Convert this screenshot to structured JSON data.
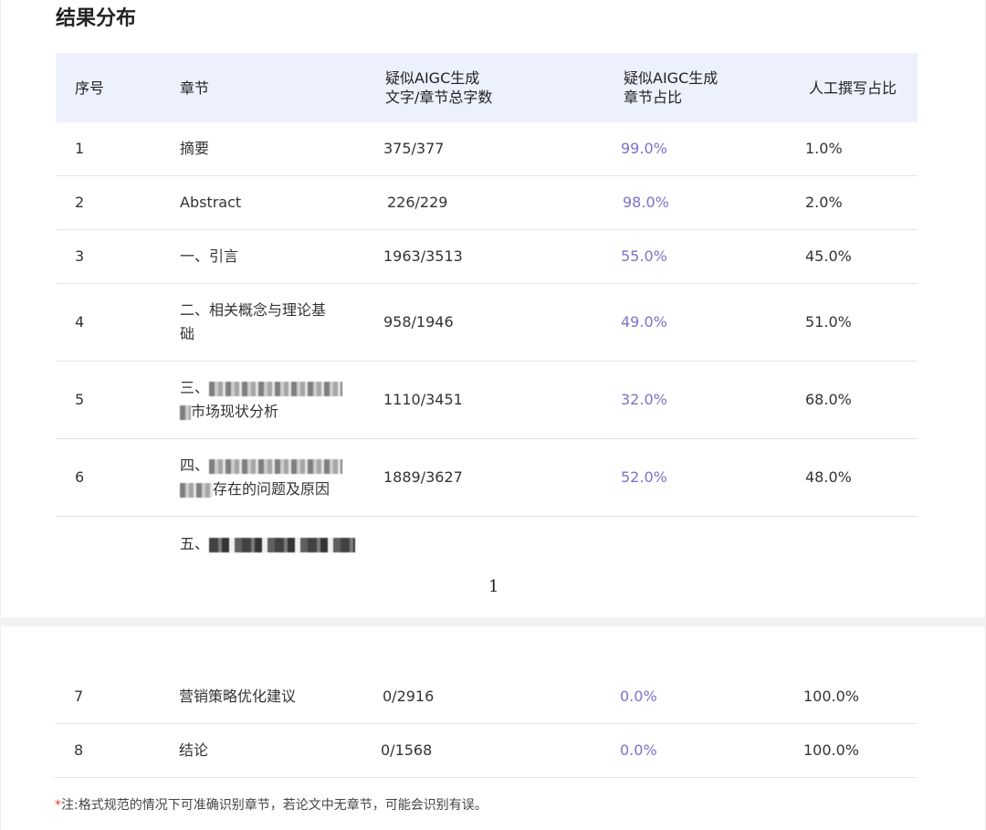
{
  "title": "结果分布",
  "table": {
    "headers": {
      "no": "序号",
      "chapter": "章节",
      "ai_chars_line1": "疑似AIGC生成",
      "ai_chars_line2": "文字/章节总字数",
      "ai_ratio_line1": "疑似AIGC生成",
      "ai_ratio_line2": "章节占比",
      "human_ratio": "人工撰写占比"
    },
    "rows": [
      {
        "no": "1",
        "chapter": "摘要",
        "ai_chars": "375/377",
        "ai_ratio": "99.0%",
        "human_ratio": "1.0%"
      },
      {
        "no": "2",
        "chapter": "Abstract",
        "ai_chars": "226/229",
        "ai_ratio": "98.0%",
        "human_ratio": "2.0%"
      },
      {
        "no": "3",
        "chapter": "一、引言",
        "ai_chars": "1963/3513",
        "ai_ratio": "55.0%",
        "human_ratio": "45.0%"
      },
      {
        "no": "4",
        "chapter_line1": "二、相关概念与理论基",
        "chapter_line2": "础",
        "ai_chars": "958/1946",
        "ai_ratio": "49.0%",
        "human_ratio": "51.0%"
      },
      {
        "no": "5",
        "chapter_prefix": "三、",
        "chapter_line2_suffix": "市场现状分析",
        "ai_chars": "1110/3451",
        "ai_ratio": "32.0%",
        "human_ratio": "68.0%"
      },
      {
        "no": "6",
        "chapter_prefix": "四、",
        "chapter_line2_suffix": "存在的问题及原因",
        "ai_chars": "1889/3627",
        "ai_ratio": "52.0%",
        "human_ratio": "48.0%"
      },
      {
        "chapter_prefix": "五、"
      },
      {
        "no": "7",
        "chapter": "营销策略优化建议",
        "ai_chars": "0/2916",
        "ai_ratio": "0.0%",
        "human_ratio": "100.0%"
      },
      {
        "no": "8",
        "chapter": "结论",
        "ai_chars": "0/1568",
        "ai_ratio": "0.0%",
        "human_ratio": "100.0%"
      }
    ]
  },
  "page_number": "1",
  "note": {
    "star": "*",
    "text": "注:格式规范的情况下可准确识别章节，若论文中无章节，可能会识别有误。"
  },
  "colors": {
    "header_bg": "#edf0fd",
    "ratio_text": "#7b72c9",
    "note_star": "#e0433b"
  }
}
